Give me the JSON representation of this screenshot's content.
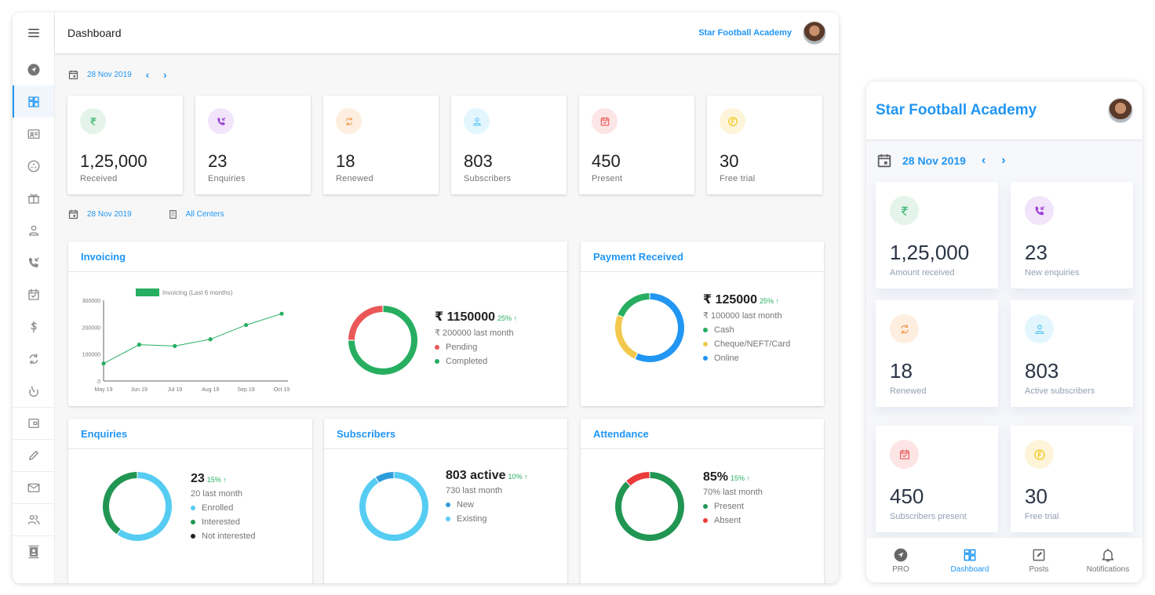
{
  "desktop": {
    "header": {
      "title": "Dashboard",
      "academy": "Star Football Academy"
    },
    "date": "28 Nov 2019",
    "filter": {
      "date": "28 Nov 2019",
      "centers": "All Centers"
    },
    "sidebar": [
      {
        "icon": "pro-icon"
      },
      {
        "icon": "dashboard-icon",
        "active": true
      },
      {
        "icon": "id-card-icon"
      },
      {
        "icon": "groups-icon"
      },
      {
        "icon": "gift-icon"
      },
      {
        "icon": "person-icon"
      },
      {
        "icon": "incoming-call-icon"
      },
      {
        "icon": "calendar-check-icon"
      },
      {
        "icon": "dollar-icon"
      },
      {
        "icon": "renew-icon"
      },
      {
        "icon": "timer-icon"
      },
      {
        "icon": "wallet-icon"
      },
      {
        "icon": "pencil-icon"
      },
      {
        "icon": "mail-icon"
      },
      {
        "icon": "people-icon"
      },
      {
        "icon": "contacts-icon"
      }
    ],
    "stats": [
      {
        "icon": "rupee-icon",
        "value": "1,25,000",
        "label": "Received",
        "color": "#27ae60",
        "bg": "#e4f4ea"
      },
      {
        "icon": "incoming-call-icon",
        "value": "23",
        "label": "Enquiries",
        "color": "#9b3fd6",
        "bg": "#f1e4fb"
      },
      {
        "icon": "renew-icon",
        "value": "18",
        "label": "Renewed",
        "color": "#f2994a",
        "bg": "#fdeee0"
      },
      {
        "icon": "person-icon",
        "value": "803",
        "label": "Subscribers",
        "color": "#4fc3f7",
        "bg": "#e3f6fd"
      },
      {
        "icon": "calendar-check-icon",
        "value": "450",
        "label": "Present",
        "color": "#eb5757",
        "bg": "#fde5e5"
      },
      {
        "icon": "free-trial-icon",
        "value": "30",
        "label": "Free trial",
        "color": "#f2c200",
        "bg": "#fdf4d9"
      }
    ],
    "panels": {
      "invoicing": {
        "title": "Invoicing",
        "amount": "₹ 1150000",
        "change": "25% ↑",
        "last": "₹ 200000 last month"
      },
      "payment": {
        "title": "Payment Received",
        "amount": "₹ 125000",
        "change": "25% ↑",
        "last": "₹ 100000 last month"
      },
      "enquiries": {
        "title": "Enquiries",
        "amount": "23",
        "change": "15% ↑",
        "last": "20 last month"
      },
      "subscribers": {
        "title": "Subscribers",
        "amount": "803 active",
        "change": "10% ↑",
        "last": "730 last month"
      },
      "attendance": {
        "title": "Attendance",
        "amount": "85%",
        "change": "15% ↑",
        "last": "70% last month"
      }
    }
  },
  "chart_data": [
    {
      "id": "invoicing-line",
      "type": "line",
      "title": "",
      "legend": "Invoicing (Last 6 months)",
      "categories": [
        "May 19",
        "Jun 19",
        "Jul 19",
        "Aug 19",
        "Sep 19",
        "Oct 19"
      ],
      "values": [
        65000,
        135000,
        130000,
        155000,
        208000,
        250000
      ],
      "yticks": [
        "0",
        "100000",
        "200000",
        "300000"
      ],
      "ylim": [
        0,
        300000
      ],
      "color": "#27ae60"
    },
    {
      "id": "invoicing-donut",
      "type": "pie",
      "slices": [
        {
          "label": "Completed",
          "value": 75,
          "color": "#27ae60"
        },
        {
          "label": "Pending",
          "value": 25,
          "color": "#eb5757"
        }
      ],
      "legend_order": [
        "Pending",
        "Completed"
      ]
    },
    {
      "id": "payment-donut",
      "type": "pie",
      "slices": [
        {
          "label": "Online",
          "value": 57,
          "color": "#2196f3"
        },
        {
          "label": "Cheque/NEFT/Card",
          "value": 24,
          "color": "#f2c94c"
        },
        {
          "label": "Cash",
          "value": 19,
          "color": "#27ae60"
        }
      ],
      "legend_order": [
        "Cash",
        "Cheque/NEFT/Card",
        "Online"
      ]
    },
    {
      "id": "enquiries-donut",
      "type": "pie",
      "slices": [
        {
          "label": "Enrolled",
          "value": 60,
          "color": "#56ccf2"
        },
        {
          "label": "Interested",
          "value": 40,
          "color": "#219653"
        },
        {
          "label": "Not interested",
          "value": 0,
          "color": "#222222"
        }
      ],
      "legend_order": [
        "Enrolled",
        "Interested",
        "Not interested"
      ]
    },
    {
      "id": "subscribers-donut",
      "type": "pie",
      "slices": [
        {
          "label": "Existing",
          "value": 91,
          "color": "#56ccf2"
        },
        {
          "label": "New",
          "value": 9,
          "color": "#2d9cdb"
        }
      ],
      "legend_order": [
        "New",
        "Existing"
      ]
    },
    {
      "id": "attendance-donut",
      "type": "pie",
      "slices": [
        {
          "label": "Present",
          "value": 88,
          "color": "#219653"
        },
        {
          "label": "Absent",
          "value": 12,
          "color": "#eb3b3b"
        }
      ],
      "legend_order": [
        "Present",
        "Absent"
      ]
    }
  ],
  "mobile": {
    "title": "Star Football Academy",
    "date": "28 Nov 2019",
    "cards": [
      {
        "icon": "rupee-icon",
        "value": "1,25,000",
        "label": "Amount received",
        "color": "#27ae60",
        "bg": "#e4f4ea"
      },
      {
        "icon": "incoming-call-icon",
        "value": "23",
        "label": "New enquiries",
        "color": "#9b3fd6",
        "bg": "#f1e4fb"
      },
      {
        "icon": "renew-icon",
        "value": "18",
        "label": "Renewed",
        "color": "#f2994a",
        "bg": "#fdeee0"
      },
      {
        "icon": "person-icon",
        "value": "803",
        "label": "Active subscribers",
        "color": "#4fc3f7",
        "bg": "#e3f6fd"
      },
      {
        "icon": "calendar-check-icon",
        "value": "450",
        "label": "Subscribers present",
        "color": "#eb5757",
        "bg": "#fde5e5"
      },
      {
        "icon": "free-trial-icon",
        "value": "30",
        "label": "Free trial",
        "color": "#f2c200",
        "bg": "#fdf4d9"
      }
    ],
    "nav": [
      {
        "icon": "pro-icon",
        "label": "PRO"
      },
      {
        "icon": "dashboard-icon",
        "label": "Dashboard",
        "active": true
      },
      {
        "icon": "posts-icon",
        "label": "Posts"
      },
      {
        "icon": "bell-icon",
        "label": "Notifications"
      }
    ]
  }
}
